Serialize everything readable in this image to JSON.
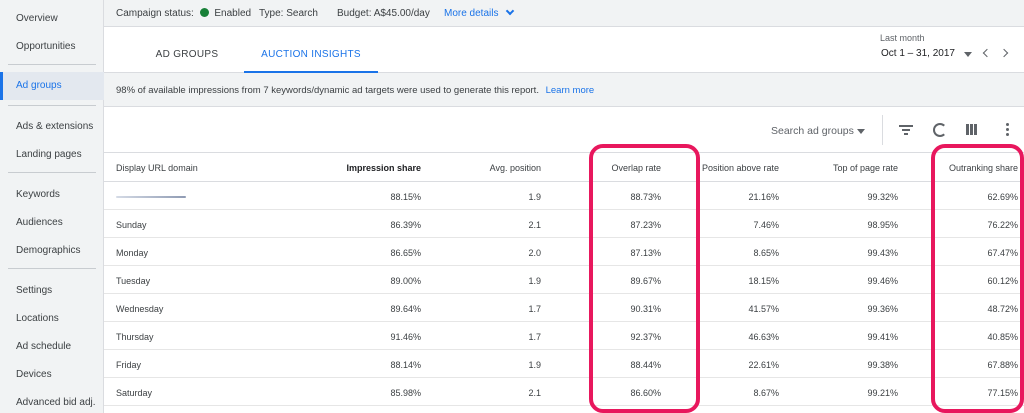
{
  "sidebar": {
    "items": [
      {
        "label": "Overview"
      },
      {
        "label": "Opportunities"
      },
      {
        "label": "Ad groups",
        "active": true
      },
      {
        "label": "Ads & extensions"
      },
      {
        "label": "Landing pages"
      },
      {
        "label": "Keywords"
      },
      {
        "label": "Audiences"
      },
      {
        "label": "Demographics"
      },
      {
        "label": "Settings"
      },
      {
        "label": "Locations"
      },
      {
        "label": "Ad schedule"
      },
      {
        "label": "Devices"
      },
      {
        "label": "Advanced bid adj."
      }
    ]
  },
  "status": {
    "campaign_label": "Campaign status:",
    "campaign_value": "Enabled",
    "status_color": "#188038",
    "type": "Type: Search",
    "budget": "Budget: A$45.00/day",
    "more_details": "More details"
  },
  "tabs": [
    {
      "label": "AD GROUPS"
    },
    {
      "label": "AUCTION INSIGHTS",
      "active": true
    }
  ],
  "date_range": {
    "label": "Last month",
    "value": "Oct 1 – 31, 2017"
  },
  "notice": {
    "text": "98% of available impressions from 7 keywords/dynamic ad targets were used to generate this report.",
    "link": "Learn more"
  },
  "toolbar": {
    "search_label": "Search ad groups",
    "icons": [
      "filter-icon",
      "segment-icon",
      "columns-icon",
      "more-vert-icon"
    ]
  },
  "table": {
    "headers": [
      "Display URL domain",
      "Impression share",
      "Avg. position",
      "Overlap rate",
      "Position above rate",
      "Top of page rate",
      "Outranking share"
    ],
    "rows": [
      [
        "",
        "88.15%",
        "1.9",
        "88.73%",
        "21.16%",
        "99.32%",
        "62.69%"
      ],
      [
        "Sunday",
        "86.39%",
        "2.1",
        "87.23%",
        "7.46%",
        "98.95%",
        "76.22%"
      ],
      [
        "Monday",
        "86.65%",
        "2.0",
        "87.13%",
        "8.65%",
        "99.43%",
        "67.47%"
      ],
      [
        "Tuesday",
        "89.00%",
        "1.9",
        "89.67%",
        "18.15%",
        "99.46%",
        "60.12%"
      ],
      [
        "Wednesday",
        "89.64%",
        "1.7",
        "90.31%",
        "41.57%",
        "99.36%",
        "48.72%"
      ],
      [
        "Thursday",
        "91.46%",
        "1.7",
        "92.37%",
        "46.63%",
        "99.41%",
        "40.85%"
      ],
      [
        "Friday",
        "88.14%",
        "1.9",
        "88.44%",
        "22.61%",
        "99.38%",
        "67.88%"
      ],
      [
        "Saturday",
        "85.98%",
        "2.1",
        "86.60%",
        "8.67%",
        "99.21%",
        "77.15%"
      ]
    ]
  },
  "colors": {
    "accent": "#1a73e8",
    "highlight": "#e8175d"
  }
}
